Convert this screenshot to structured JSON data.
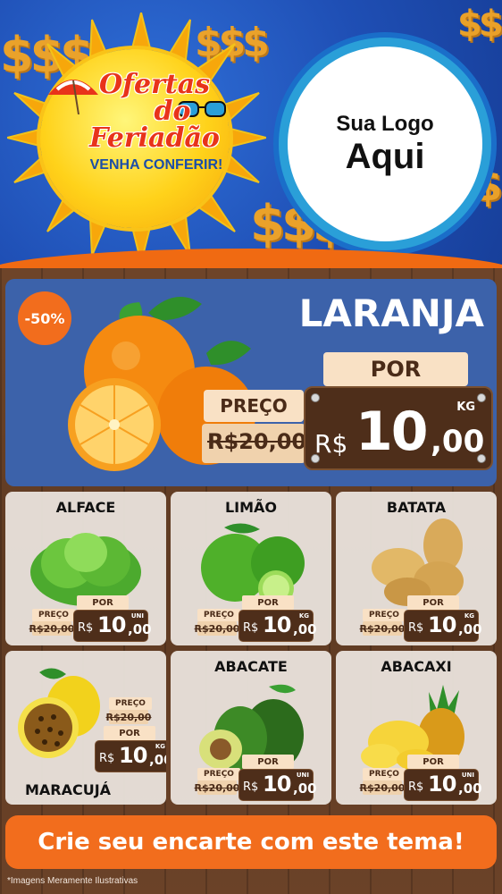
{
  "header": {
    "offer_title_line1": "Ofertas",
    "offer_title_line2": "do",
    "offer_title_line3": "Feriadão",
    "offer_subtitle": "VENHA CONFERIR!",
    "logo_line1": "Sua Logo",
    "logo_line2": "Aqui",
    "dollar_symbol": "$$$"
  },
  "featured": {
    "name": "LARANJA",
    "discount": "-50%",
    "por_label": "POR",
    "preco_label": "PREÇO",
    "old_price": "R$20,00",
    "currency": "R$",
    "price_int": "10",
    "price_cents": ",00",
    "unit": "KG",
    "image_icon": "orange-fruit-icon"
  },
  "products": [
    {
      "name": "ALFACE",
      "preco_label": "PREÇO",
      "old_price": "R$20,00",
      "por_label": "POR",
      "currency": "R$",
      "price_int": "10",
      "price_cents": ",00",
      "unit": "UNI",
      "icon": "lettuce-icon"
    },
    {
      "name": "LIMÃO",
      "preco_label": "PREÇO",
      "old_price": "R$20,00",
      "por_label": "POR",
      "currency": "R$",
      "price_int": "10",
      "price_cents": ",00",
      "unit": "KG",
      "icon": "lime-icon"
    },
    {
      "name": "BATATA",
      "preco_label": "PREÇO",
      "old_price": "R$20,00",
      "por_label": "POR",
      "currency": "R$",
      "price_int": "10",
      "price_cents": ",00",
      "unit": "KG",
      "icon": "potato-icon"
    },
    {
      "name": "MARACUJÁ",
      "preco_label": "PREÇO",
      "old_price": "R$20,00",
      "por_label": "POR",
      "currency": "R$",
      "price_int": "10",
      "price_cents": ",00",
      "unit": "KG",
      "icon": "passion-fruit-icon"
    },
    {
      "name": "ABACATE",
      "preco_label": "PREÇO",
      "old_price": "R$20,00",
      "por_label": "POR",
      "currency": "R$",
      "price_int": "10",
      "price_cents": ",00",
      "unit": "UNI",
      "icon": "avocado-icon"
    },
    {
      "name": "ABACAXI",
      "preco_label": "PREÇO",
      "old_price": "R$20,00",
      "por_label": "POR",
      "currency": "R$",
      "price_int": "10",
      "price_cents": ",00",
      "unit": "UNI",
      "icon": "pineapple-icon"
    }
  ],
  "cta": {
    "label": "Crie seu encarte com este tema!"
  },
  "footnote": "*Imagens Meramente Ilustrativas",
  "colors": {
    "header_blue": "#1f4fb5",
    "accent_orange": "#f26d1d",
    "sun_yellow": "#ffd21a",
    "tag_cream": "#f9e1c5",
    "board_brown": "#4e2e1a",
    "featured_blue": "#3c62aa"
  }
}
